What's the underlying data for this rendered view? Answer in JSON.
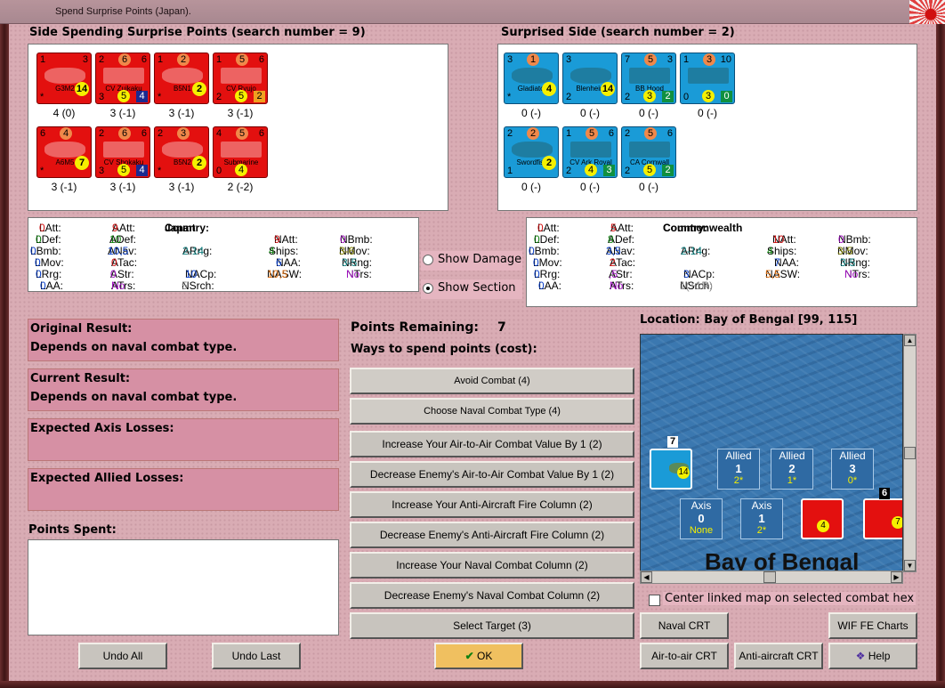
{
  "window": {
    "title": "Spend Surprise Points (Japan)."
  },
  "headers": {
    "spending": "Side Spending Surprise Points (search number = 9)",
    "surprised": "Surprised Side (search number = 2)"
  },
  "axis_units": [
    {
      "name": "G3M2",
      "tl": "1",
      "tm": "",
      "tr": "3",
      "br": "14",
      "bl": "*",
      "bc": "",
      "bsq": "",
      "label": "4 (0)"
    },
    {
      "name": "CV Zuikaku",
      "tl": "2",
      "tm": "6",
      "tr": "6",
      "br": "",
      "bl": "3",
      "bc": "5",
      "bsq": "4",
      "label": "3 (-1)"
    },
    {
      "name": "B5N1",
      "tl": "1",
      "tm": "2",
      "tr": "",
      "br": "2",
      "bl": "*",
      "bc": "",
      "bsq": "",
      "label": "3 (-1)"
    },
    {
      "name": "CV Ryujo",
      "tl": "1",
      "tm": "5",
      "tr": "6",
      "br": "",
      "bl": "2",
      "bc": "5",
      "bsq": "2",
      "label": "3 (-1)"
    },
    {
      "name": "A6M5",
      "tl": "6",
      "tm": "4",
      "tr": "",
      "br": "7",
      "bl": "*",
      "bc": "",
      "bsq": "",
      "label": "3 (-1)"
    },
    {
      "name": "CV Shokaku",
      "tl": "2",
      "tm": "6",
      "tr": "6",
      "br": "",
      "bl": "3",
      "bc": "5",
      "bsq": "4",
      "label": "3 (-1)"
    },
    {
      "name": "B5N2",
      "tl": "2",
      "tm": "3",
      "tr": "",
      "br": "2",
      "bl": "*",
      "bc": "",
      "bsq": "",
      "label": "3 (-1)"
    },
    {
      "name": "Submarine",
      "tl": "4",
      "tm": "5",
      "tr": "6",
      "br": "",
      "bl": "0",
      "bc": "4",
      "bsq": "",
      "label": "2 (-2)"
    }
  ],
  "allied_units": [
    {
      "name": "Gladiator",
      "tl": "3",
      "tm": "1",
      "tr": "",
      "br": "4",
      "bl": "*",
      "bc": "",
      "bsq": "",
      "label": "0 (-)"
    },
    {
      "name": "Blenheim",
      "tl": "3",
      "tm": "",
      "tr": "",
      "br": "14",
      "bl": "2",
      "bc": "",
      "bsq": "",
      "label": "0 (-)"
    },
    {
      "name": "BB Hood",
      "tl": "7",
      "tm": "5",
      "tr": "3",
      "br": "",
      "bl": "2",
      "bc": "3",
      "bsq": "2",
      "label": "0 (-)"
    },
    {
      "name": "",
      "tl": "1",
      "tm": "3",
      "tr": "10",
      "br": "",
      "bl": "0",
      "bc": "3",
      "bsq": "0",
      "label": "0 (-)"
    },
    {
      "name": "Swordfish",
      "tl": "2",
      "tm": "2",
      "tr": "",
      "br": "2",
      "bl": "1",
      "bc": "",
      "bsq": "",
      "label": "0 (-)"
    },
    {
      "name": "CV Ark Royal",
      "tl": "1",
      "tm": "5",
      "tr": "6",
      "br": "",
      "bl": "2",
      "bc": "4",
      "bsq": "3",
      "label": "0 (-)"
    },
    {
      "name": "CA Cornwall",
      "tl": "2",
      "tm": "5",
      "tr": "6",
      "br": "",
      "bl": "2",
      "bc": "5",
      "bsq": "2",
      "label": "0 (-)"
    }
  ],
  "axis_stats": {
    "country_label": "Country:",
    "country": "Japan",
    "LAtt": "0",
    "LDef": "0",
    "LBmb": "0",
    "LMov": "0",
    "LRrg": "0",
    "LAA": "0",
    "AAtt": "9",
    "ADef": "10",
    "ANav": "10,5",
    "ATac": "0",
    "AStr": "0",
    "ATrs": "No",
    "ARng": "2-14",
    "NACp": "10",
    "NSrch": "5",
    "NAtt": "9",
    "Ships": "4",
    "NAA": "6",
    "NASW": "10,5",
    "NBmb": "0",
    "NMov": "3-6",
    "NRng": "3-5",
    "NTrs": "No"
  },
  "allied_stats": {
    "country_label": "Country:",
    "country": "Commonwealth",
    "LAtt": "0",
    "LDef": "0",
    "LBmb": "0",
    "LMov": "0",
    "LRrg": "0",
    "LAA": "0",
    "AAtt": "5",
    "ADef": "8",
    "ANav": "3,5",
    "ATac": "2",
    "AStr": ",5",
    "ATrs": "No",
    "ARng": "2-14",
    "NACp": "3",
    "NSrch": "1(+1R)",
    "NAtt": "10",
    "Ships": "4",
    "NAA": "7",
    "NASW": "5,5",
    "NBmb": "0",
    "NMov": "3-5",
    "NRng": "3-5",
    "NTrs": "No"
  },
  "options": {
    "show_damage": "Show Damage",
    "show_section": "Show Section"
  },
  "results": {
    "original_label": "Original Result:",
    "original_value": "Depends on naval combat type.",
    "current_label": "Current Result:",
    "current_value": "Depends on naval combat type.",
    "axis_losses_label": "Expected Axis Losses:",
    "allied_losses_label": "Expected Allied Losses:",
    "points_spent_label": "Points Spent:"
  },
  "points": {
    "remaining_label": "Points Remaining:",
    "remaining_value": "7",
    "ways_label": "Ways to spend points (cost):"
  },
  "spend_buttons": [
    "Avoid Combat (4)",
    "Choose Naval Combat Type (4)",
    "Increase Your Air-to-Air Combat Value By 1 (2)",
    "Decrease Enemy's Air-to-Air Combat Value By 1 (2)",
    "Increase Your Anti-Aircraft Fire Column (2)",
    "Decrease Enemy's Anti-Aircraft Fire Column (2)",
    "Increase Your Naval Combat Column (2)",
    "Decrease Enemy's Naval Combat Column (2)",
    "Select Target (3)"
  ],
  "map": {
    "location": "Location: Bay of Bengal [99, 115]",
    "label": "Bay of Bengal",
    "boxes": [
      {
        "side": "Allied",
        "num": "1",
        "sub": "2*"
      },
      {
        "side": "Allied",
        "num": "2",
        "sub": "1*"
      },
      {
        "side": "Allied",
        "num": "3",
        "sub": "0*"
      },
      {
        "side": "Axis",
        "num": "0",
        "sub": "None"
      },
      {
        "side": "Axis",
        "num": "1",
        "sub": "2*"
      }
    ],
    "stack_blenheim": "7",
    "stack_a6m5": "6",
    "center_checkbox": "Center linked map on selected combat hex"
  },
  "buttons": {
    "undo_all": "Undo All",
    "undo_last": "Undo Last",
    "ok": "OK",
    "naval_crt": "Naval CRT",
    "wif_charts": "WIF FE Charts",
    "air_crt": "Air-to-air CRT",
    "aa_crt": "Anti-aircraft CRT",
    "help": "Help"
  }
}
